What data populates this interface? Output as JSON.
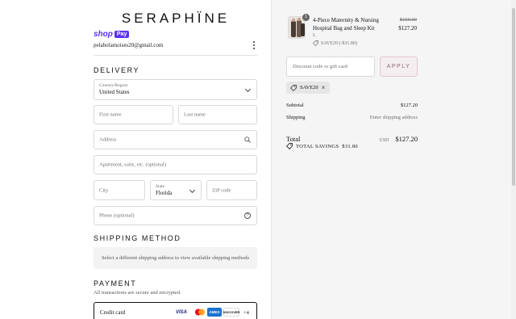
{
  "brand": {
    "name": "SERAPHÏNE"
  },
  "shop_pay": {
    "shop": "shop",
    "pay": "Pay"
  },
  "account": {
    "email": "pelabolamoises20@gmail.com"
  },
  "delivery": {
    "heading": "DELIVERY",
    "country_label": "Country/Region",
    "country_value": "United States",
    "first_name_ph": "First name",
    "last_name_ph": "Last name",
    "address_ph": "Address",
    "apartment_ph": "Apartment, suite, etc. (optional)",
    "city_ph": "City",
    "state_label": "State",
    "state_value": "Florida",
    "zip_ph": "ZIP code",
    "phone_ph": "Phone (optional)"
  },
  "shipping_method": {
    "heading": "SHIPPING METHOD",
    "note": "Select a different shipping address to view available shipping methods"
  },
  "payment": {
    "heading": "PAYMENT",
    "subtitle": "All transactions are secure and encrypted.",
    "method_label": "Credit card",
    "cards": [
      "VISA",
      "mastercard",
      "AMEX",
      "DISCOVER"
    ],
    "more": "+4"
  },
  "summary": {
    "item": {
      "title": "4-Piece Maternity & Nursing Hospital Bag and Sleep Kit",
      "variant": "L",
      "discount": "SAVE20 (-$31.80)",
      "qty": "1",
      "price_old": "$159.00",
      "price_new": "$127.20"
    },
    "discount_ph": "Discount code or gift card",
    "apply_label": "APPLY",
    "applied_code": "SAVE20",
    "subtotal_label": "Subtotal",
    "subtotal_value": "$127.20",
    "shipping_label": "Shipping",
    "shipping_value": "Enter shipping address",
    "total_label": "Total",
    "currency": "USD",
    "total_value": "$127.20",
    "savings_label": "TOTAL SAVINGS",
    "savings_value": "$31.80"
  },
  "colors": {
    "shop_pay": "#5a31f4",
    "apply_bg": "#f5eef0",
    "sidebar_bg": "#f5f5f5"
  }
}
